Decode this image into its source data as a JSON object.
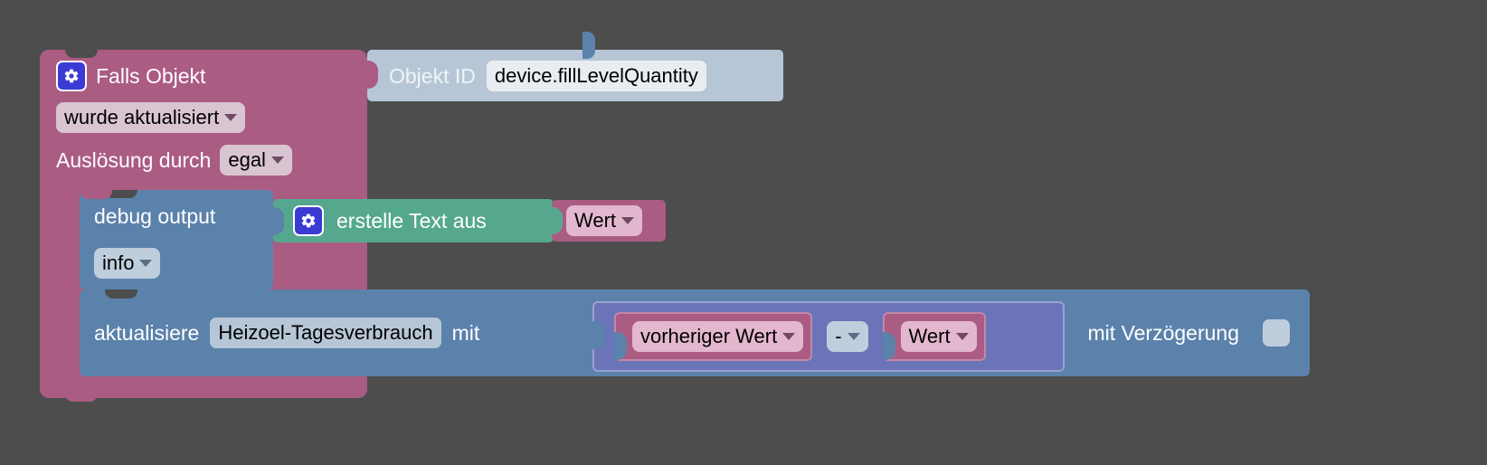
{
  "workspace": {
    "background_color": "#4d4d4d",
    "language": "de"
  },
  "blocks": {
    "trigger": {
      "color": "#ab5c83",
      "gear_icon": "gear-icon",
      "title": "Falls Objekt",
      "condition_dropdown": "wurde aktualisiert",
      "source_label": "Auslösung durch",
      "source_dropdown": "egal",
      "object_input": {
        "color": "#b6c6d6",
        "label": "Objekt ID",
        "value": "device.fillLevelQuantity"
      }
    },
    "debug": {
      "color": "#5b82ab",
      "label": "debug output",
      "severity_dropdown": "info"
    },
    "create_text": {
      "color": "#55a88d",
      "gear_icon": "gear-icon",
      "label": "erstelle Text aus",
      "argument": {
        "color": "#ab5c83",
        "dropdown": "Wert"
      }
    },
    "update_state": {
      "color": "#5b82ab",
      "label": "aktualisiere",
      "target_value": "Heizoel-Tagesverbrauch",
      "with_label": "mit",
      "delay_label": "mit Verzögerung",
      "delay_checked": false,
      "expression": {
        "color": "#6b74b8",
        "left_operand": "vorheriger Wert",
        "operator": "-",
        "right_operand": "Wert"
      }
    }
  }
}
